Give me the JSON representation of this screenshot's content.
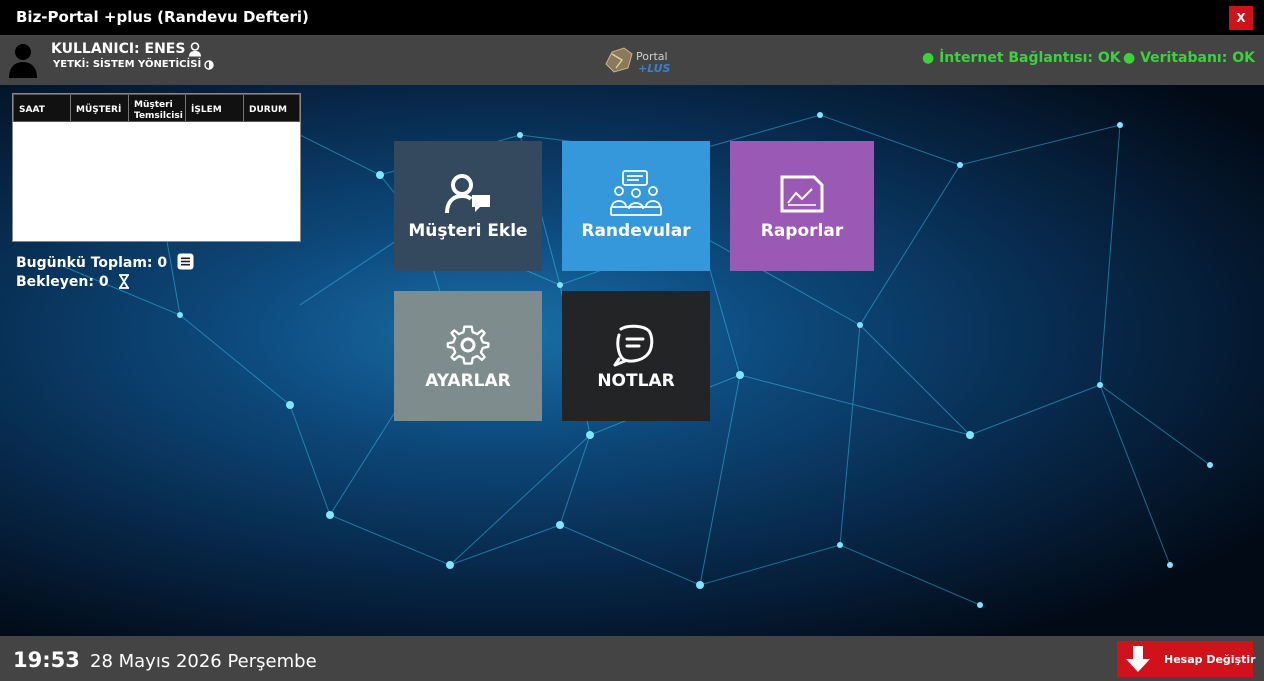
{
  "window": {
    "title": "Biz-Portal +plus (Randevu Defteri)",
    "close_label": "X"
  },
  "header": {
    "user_label": "KULLANICI: ENES",
    "role_label": "YETKİ: SİSTEM YÖNETİCİSİ",
    "logo_text_top": "Portal",
    "logo_text_bottom": "PLUS",
    "internet_status": "● İnternet Bağlantısı: OK",
    "db_status": "● Veritabanı: OK",
    "status_color": "#3bd33b"
  },
  "appointments_table": {
    "columns": [
      "SAAT",
      "MÜŞTERİ",
      "Müşteri Temsilcisi",
      "İŞLEM",
      "DURUM"
    ],
    "rows": []
  },
  "summary": {
    "today_total": "Bugünkü Toplam: 0",
    "pending": "Bekleyen: 0"
  },
  "tiles": [
    {
      "label": "Müşteri Ekle",
      "icon": "add-customer-icon",
      "color": "#34495e"
    },
    {
      "label": "Randevular",
      "icon": "appointments-icon",
      "color": "#3498db"
    },
    {
      "label": "Raporlar",
      "icon": "reports-icon",
      "color": "#9b59b6"
    },
    {
      "label": "AYARLAR",
      "icon": "gear-icon",
      "color": "#7f8c8d"
    },
    {
      "label": "NOTLAR",
      "icon": "notes-icon",
      "color": "#222426"
    }
  ],
  "footer": {
    "time": "19:53",
    "date": "28 Mayıs 2026 Perşembe",
    "switch_account_label": "Hesap Değiştir",
    "accent": "#d0121b"
  }
}
